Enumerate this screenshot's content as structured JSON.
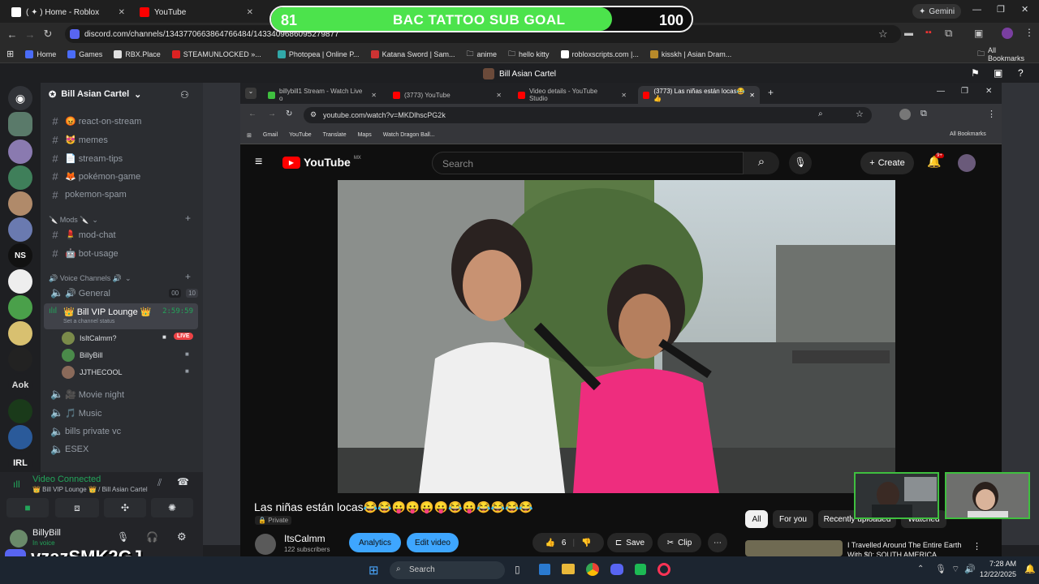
{
  "outer_tabs": [
    {
      "label": "( ✦ ) Home - Roblox"
    },
    {
      "label": "YouTube"
    }
  ],
  "outer_url": "discord.com/channels/1343770663864766484/1433409686095279877",
  "bookmarks": [
    "Home",
    "Games",
    "RBX.Place",
    "STEAMUNLOCKED »...",
    "Photopea | Online P...",
    "Katana Sword | Sam...",
    "anime",
    "hello kitty",
    "robloxscripts.com |...",
    "kisskh | Asian Dram..."
  ],
  "all_bookmarks": "All Bookmarks",
  "gemini": "Gemini",
  "goal": {
    "current": "81",
    "title": "BAC TATTOO SUB GOAL",
    "target": "100",
    "progress": 0.81
  },
  "discord_title": "Bill Asian Cartel",
  "server_name": "Bill Asian Cartel",
  "channels": [
    {
      "name": "😡 react-on-stream"
    },
    {
      "name": "😻 memes"
    },
    {
      "name": "📄 stream-tips"
    },
    {
      "name": "🦊 pokémon-game"
    },
    {
      "name": "pokemon-spam"
    }
  ],
  "mods_category": "🔪 Mods 🔪",
  "mod_channels": [
    {
      "name": "💄 mod-chat"
    },
    {
      "name": "🤖 bot-usage"
    }
  ],
  "voice_category": "🔊 Voice Channels 🔊",
  "general": {
    "name": "🔊 General",
    "c1": "00",
    "c2": "10"
  },
  "vip": {
    "name": "👑 Bill VIP Lounge 👑",
    "timer": "2:59:59",
    "status": "Set a channel status"
  },
  "vip_users": [
    {
      "name": "IsItCalmm?",
      "live": "LIVE"
    },
    {
      "name": "BillyBill"
    },
    {
      "name": "JJTHECOOL"
    }
  ],
  "other_voice": [
    {
      "name": "🎥 Movie night"
    },
    {
      "name": "🎵 Music"
    },
    {
      "name": "bills private vc"
    },
    {
      "name": "ESEX"
    }
  ],
  "vc": {
    "status": "Video Connected",
    "location": "👑 Bill VIP Lounge 👑 / Bill Asian Cartel"
  },
  "self": {
    "name": "BillyBill",
    "sub": "In voice"
  },
  "watermark": "vzazSMK2GJ",
  "inner_tabs": [
    {
      "label": "billybill1 Stream - Watch Live o"
    },
    {
      "label": "(3773) YouTube"
    },
    {
      "label": "Video details - YouTube Studio"
    },
    {
      "label": "(3773) Las niñas están locas😂👍"
    }
  ],
  "inner_url": "youtube.com/watch?v=MKDlhscPG2k",
  "inner_bookmarks": [
    "Gmail",
    "YouTube",
    "Translate",
    "Maps",
    "Watch Dragon Ball..."
  ],
  "inner_all_bookmarks": "All Bookmarks",
  "yt": {
    "logo": "YouTube",
    "region": "MX",
    "search_placeholder": "Search",
    "create": "Create",
    "notif": "9+"
  },
  "video_title": "Las niñas están locas😂😂😛😛😛😛😂😛😂😂😂😂",
  "privacy": "Private",
  "channel": {
    "name": "ItsCalmm",
    "subs": "122 subscribers"
  },
  "buttons": {
    "analytics": "Analytics",
    "edit": "Edit video",
    "likes": "6",
    "save": "Save",
    "clip": "Clip"
  },
  "chips": [
    "All",
    "For you",
    "Recently uploaded",
    "Watched"
  ],
  "rec": {
    "title": "I Travelled Around The Entire Earth With $0: SOUTH AMERICA"
  },
  "taskbar": {
    "search": "Search",
    "time": "7:28 AM",
    "date": "12/22/2025"
  },
  "colors": {
    "discord_bg": "#313338",
    "accent_green": "#4ce34c",
    "live_red": "#ed4245",
    "yt_red": "#ff0000"
  }
}
